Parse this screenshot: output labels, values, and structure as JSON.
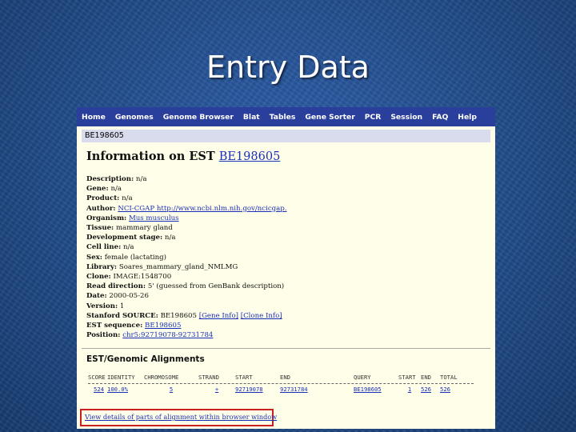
{
  "slide_title": "Entry Data",
  "nav": [
    "Home",
    "Genomes",
    "Genome Browser",
    "Blat",
    "Tables",
    "Gene Sorter",
    "PCR",
    "Session",
    "FAQ",
    "Help"
  ],
  "accession_bar": "BE198605",
  "heading": {
    "prefix": "Information on EST",
    "link": "BE198605"
  },
  "fields": [
    {
      "label": "Description:",
      "value": "n/a",
      "link": ""
    },
    {
      "label": "Gene:",
      "value": "n/a",
      "link": ""
    },
    {
      "label": "Product:",
      "value": "n/a",
      "link": ""
    },
    {
      "label": "Author:",
      "value": "",
      "link": "NCI-CGAP http://www.ncbi.nlm.nih.gov/ncicgap."
    },
    {
      "label": "Organism:",
      "value": "",
      "link": "Mus musculus"
    },
    {
      "label": "Tissue:",
      "value": "mammary gland",
      "link": ""
    },
    {
      "label": "Development stage:",
      "value": "n/a",
      "link": ""
    },
    {
      "label": "Cell line:",
      "value": "n/a",
      "link": ""
    },
    {
      "label": "Sex:",
      "value": "female (lactating)",
      "link": ""
    },
    {
      "label": "Library:",
      "value": "Soares_mammary_gland_NMLMG",
      "link": ""
    },
    {
      "label": "Clone:",
      "value": "IMAGE:1548700",
      "link": ""
    },
    {
      "label": "Read direction:",
      "value": "5' (guessed from GenBank description)",
      "link": ""
    },
    {
      "label": "Date:",
      "value": "2000-05-26",
      "link": ""
    },
    {
      "label": "Version:",
      "value": "1",
      "link": ""
    }
  ],
  "stanford": {
    "label": "Stanford SOURCE:",
    "value": "BE198605",
    "gene_info": "[Gene Info]",
    "clone_info": "[Clone Info]"
  },
  "est_sequence": {
    "label": "EST sequence:",
    "link": "BE198605"
  },
  "position": {
    "label": "Position:",
    "link": "chr5:92719078-92731784"
  },
  "alignments": {
    "title": "EST/Genomic Alignments",
    "headers": [
      "SCORE",
      "IDENTITY",
      "CHROMOSOME",
      "STRAND",
      "START",
      "END",
      "QUERY",
      "START",
      "END",
      "TOTAL"
    ],
    "rows": [
      [
        "524",
        "100.0%",
        "5",
        "+",
        "92719078",
        "92731784",
        "BE198605",
        "1",
        "526",
        "526"
      ]
    ],
    "view_link": "View details of parts of alignment within browser window"
  },
  "colors": {
    "navbar": "#2a3f9c",
    "page_bg": "#fffee8",
    "link": "#1a2fb8",
    "highlight": "#cc1f1f"
  }
}
